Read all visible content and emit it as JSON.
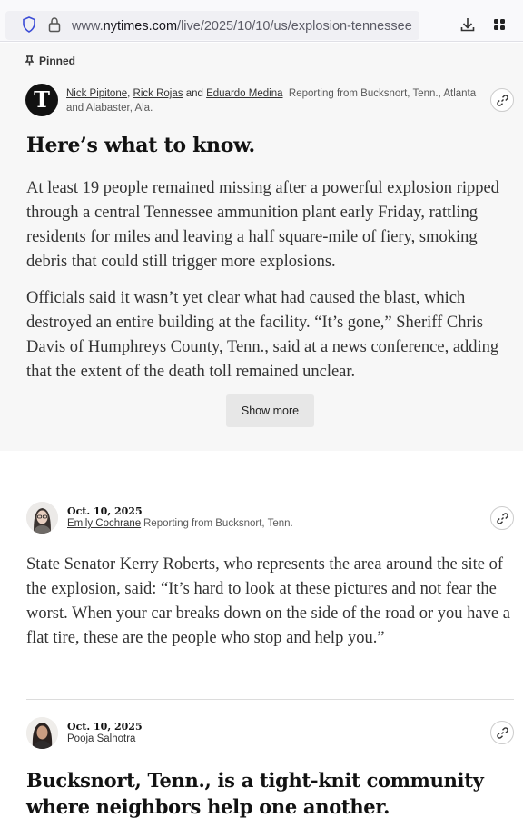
{
  "browser": {
    "url_prefix": "www.",
    "url_domain": "nytimes.com",
    "url_path": "/live/2025/10/10/us/explosion-tennessee"
  },
  "pinned": {
    "label": "Pinned",
    "logo_letter": "T",
    "authors": [
      "Nick Pipitone",
      "Rick Rojas",
      "Eduardo Medina"
    ],
    "sep_comma": ",",
    "sep_and": "and",
    "reporting": "Reporting from Bucksnort, Tenn., Atlanta and Alabaster, Ala.",
    "heading": "Here’s what to know.",
    "paragraph1": "At least 19 people remained missing after a powerful explosion ripped through a central Tennessee ammunition plant early Friday, rattling residents for miles and leaving a half square-mile of fiery, smoking debris that could still trigger more explosions.",
    "paragraph2": "Officials said it wasn’t yet clear what had caused the blast, which destroyed an entire building at the facility. “It’s gone,” Sheriff Chris Davis of Humphreys County, Tenn., said at a news conference, adding that the extent of the death toll remained unclear.",
    "show_more": "Show more"
  },
  "posts": [
    {
      "date": "Oct. 10, 2025",
      "author": "Emily Cochrane",
      "reporting": "Reporting from Bucksnort, Tenn.",
      "text": "State Senator Kerry Roberts, who represents the area around the site of the explosion, said: “It’s hard to look at these pictures and not fear the worst. When your car breaks down on the side of the road or you have a flat tire, these are the people who stop and help you.”"
    },
    {
      "date": "Oct. 10, 2025",
      "author": "Pooja Salhotra",
      "heading": "Bucksnort, Tenn., is a tight-knit community where neighbors help one another."
    }
  ],
  "colors": {
    "pinned_bg": "#f7f7f7",
    "text": "#121212"
  }
}
